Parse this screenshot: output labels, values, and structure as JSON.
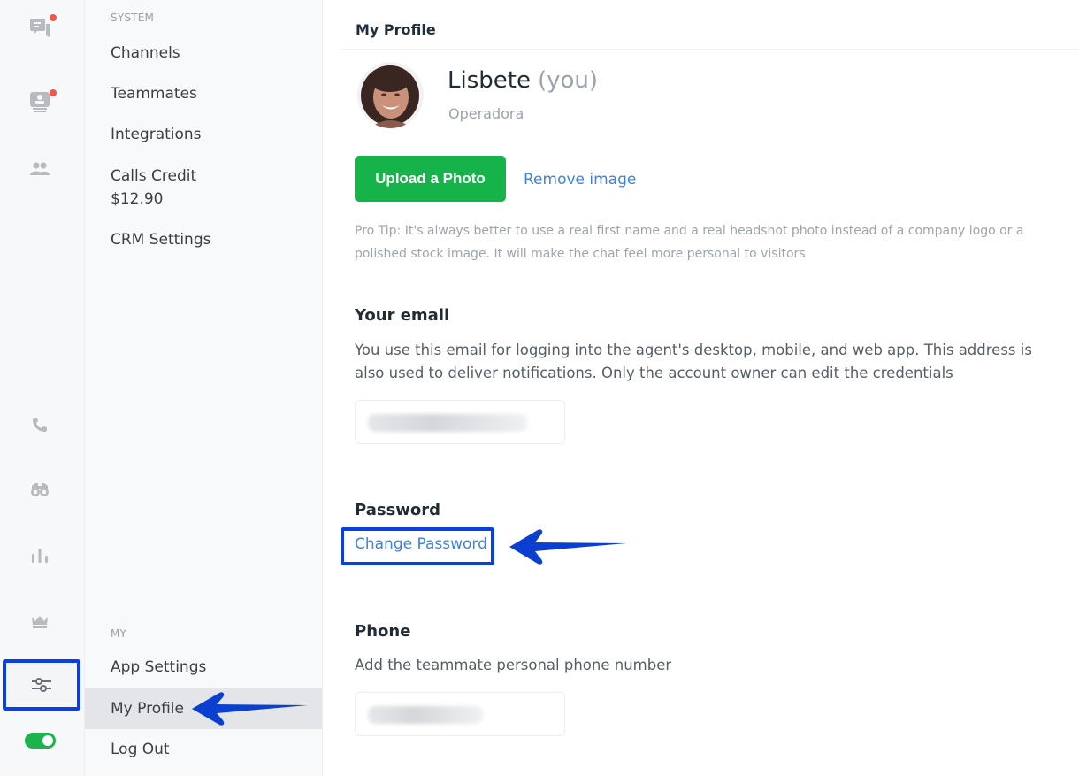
{
  "rail": {
    "icons": [
      {
        "name": "conversations-icon",
        "badge": true
      },
      {
        "name": "visitors-icon",
        "badge": true
      },
      {
        "name": "contacts-icon",
        "badge": false
      },
      {
        "name": "phone-icon",
        "badge": false
      },
      {
        "name": "binoculars-icon",
        "badge": false
      },
      {
        "name": "reports-icon",
        "badge": false
      },
      {
        "name": "crown-icon",
        "badge": false
      },
      {
        "name": "settings-sliders-icon",
        "badge": false,
        "active": true
      }
    ],
    "status_toggle_on": true,
    "colors": {
      "badge": "#f2554a",
      "toggle": "#1db34c",
      "highlight": "#0b3fe6"
    }
  },
  "nav": {
    "system_label": "SYSTEM",
    "system_items": [
      {
        "label": "Channels"
      },
      {
        "label": "Teammates"
      },
      {
        "label": "Integrations"
      },
      {
        "label": "Calls Credit",
        "sub": "$12.90"
      },
      {
        "label": "CRM Settings"
      }
    ],
    "my_label": "MY",
    "my_items": [
      {
        "label": "App Settings"
      },
      {
        "label": "My Profile",
        "active": true
      },
      {
        "label": "Log Out"
      }
    ]
  },
  "main": {
    "title": "My Profile",
    "profile": {
      "name": "Lisbete",
      "you_label": "(you)",
      "role": "Operadora"
    },
    "upload_button": "Upload a Photo",
    "remove_link": "Remove image",
    "pro_tip": "Pro Tip: It's always better to use a real first name and a real headshot photo instead of a company logo or a polished stock image. It will make the chat feel more personal to visitors",
    "email": {
      "title": "Your email",
      "description": "You use this email for logging into the agent's desktop, mobile, and web app. This address is also used to deliver notifications. Only the account owner can edit the credentials",
      "value": "(blurred)"
    },
    "password": {
      "title": "Password",
      "link": "Change Password"
    },
    "phone": {
      "title": "Phone",
      "description": "Add the teammate personal phone number",
      "value": "(blurred)"
    },
    "colors": {
      "primary_button": "#16b24a",
      "link": "#3c82df"
    }
  }
}
